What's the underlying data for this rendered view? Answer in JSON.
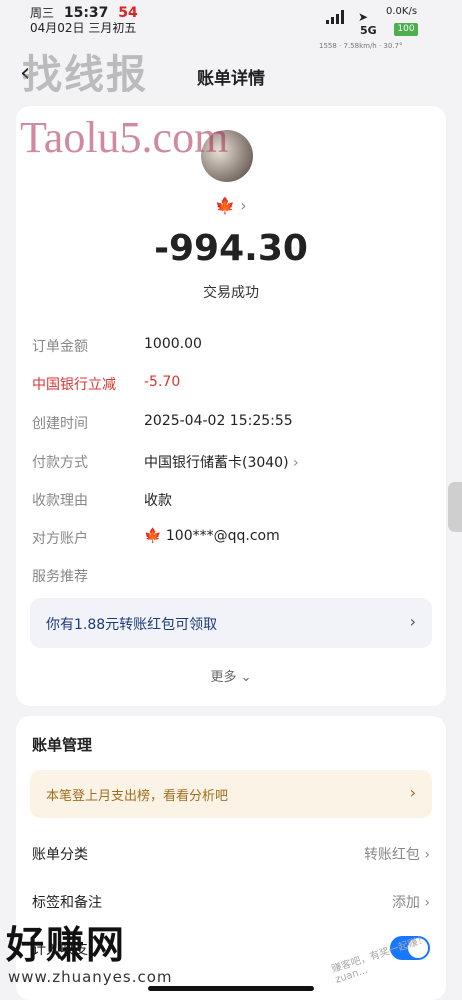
{
  "status_bar": {
    "weekday": "周三",
    "time": "15:37",
    "red_number": "54",
    "date": "04月02日",
    "lunar": "三月初五",
    "net_speed": "0.0K/s",
    "network": "5G",
    "battery": "100",
    "tiny_info": "1558 · 7.58km/h · 30.7°"
  },
  "header": {
    "back_icon": "chevron-left-icon",
    "title": "账单详情"
  },
  "watermarks": {
    "top_cn": "找线报",
    "top_en": "Taolu5.com",
    "bottom_cn": "好赚网",
    "bottom_url": "www.zhuanyes.com",
    "corner": "赚客吧，有奖一起赚！zuan..."
  },
  "transaction": {
    "merchant_icon": "maple-leaf-icon",
    "amount": "-994.30",
    "status": "交易成功",
    "details": [
      {
        "label": "订单金额",
        "value": "1000.00"
      },
      {
        "label": "中国银行立减",
        "value": "-5.70",
        "highlight": true
      },
      {
        "label": "创建时间",
        "value": "2025-04-02 15:25:55"
      },
      {
        "label": "付款方式",
        "value": "中国银行储蓄卡(3040)"
      },
      {
        "label": "收款理由",
        "value": "收款"
      },
      {
        "label": "对方账户",
        "value": "100***@qq.com"
      },
      {
        "label": "服务推荐",
        "value": ""
      }
    ],
    "promo": "你有1.88元转账红包可领取",
    "more": "更多"
  },
  "management": {
    "title": "账单管理",
    "tip": "本笔登上月支出榜，看看分析吧",
    "category_label": "账单分类",
    "category_value": "转账红包",
    "tags_label": "标签和备注",
    "tags_value": "添加",
    "toggle_label": "计入收支",
    "toggle_on": true
  },
  "colors": {
    "accent_blue": "#1677ff",
    "discount_red": "#d33333",
    "tip_brown": "#a36d1e"
  }
}
